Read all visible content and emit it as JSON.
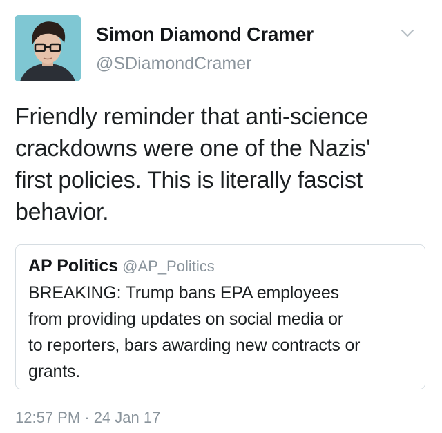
{
  "author": {
    "display_name": "Simon Diamond Cramer",
    "handle": "@SDiamondCramer",
    "avatar": "avatar-photo"
  },
  "menu_icon": "chevron-down-icon",
  "tweet": {
    "text_lines": [
      "Friendly reminder that anti-science",
      "crackdowns were one of the Nazis'",
      "first policies. This is literally fascist",
      "behavior."
    ]
  },
  "quoted_tweet": {
    "display_name": "AP Politics",
    "handle": "@AP_Politics",
    "text_lines": [
      "BREAKING: Trump bans EPA employees",
      "from providing updates on social media or",
      "to reporters, bars awarding new contracts or",
      "grants."
    ]
  },
  "timestamp": "12:57 PM · 24 Jan 17",
  "colors": {
    "secondary_text": "#8a949c",
    "primary_text": "#14171a",
    "card_border": "#d6dde2",
    "avatar_bg": "#7fc7d3"
  }
}
